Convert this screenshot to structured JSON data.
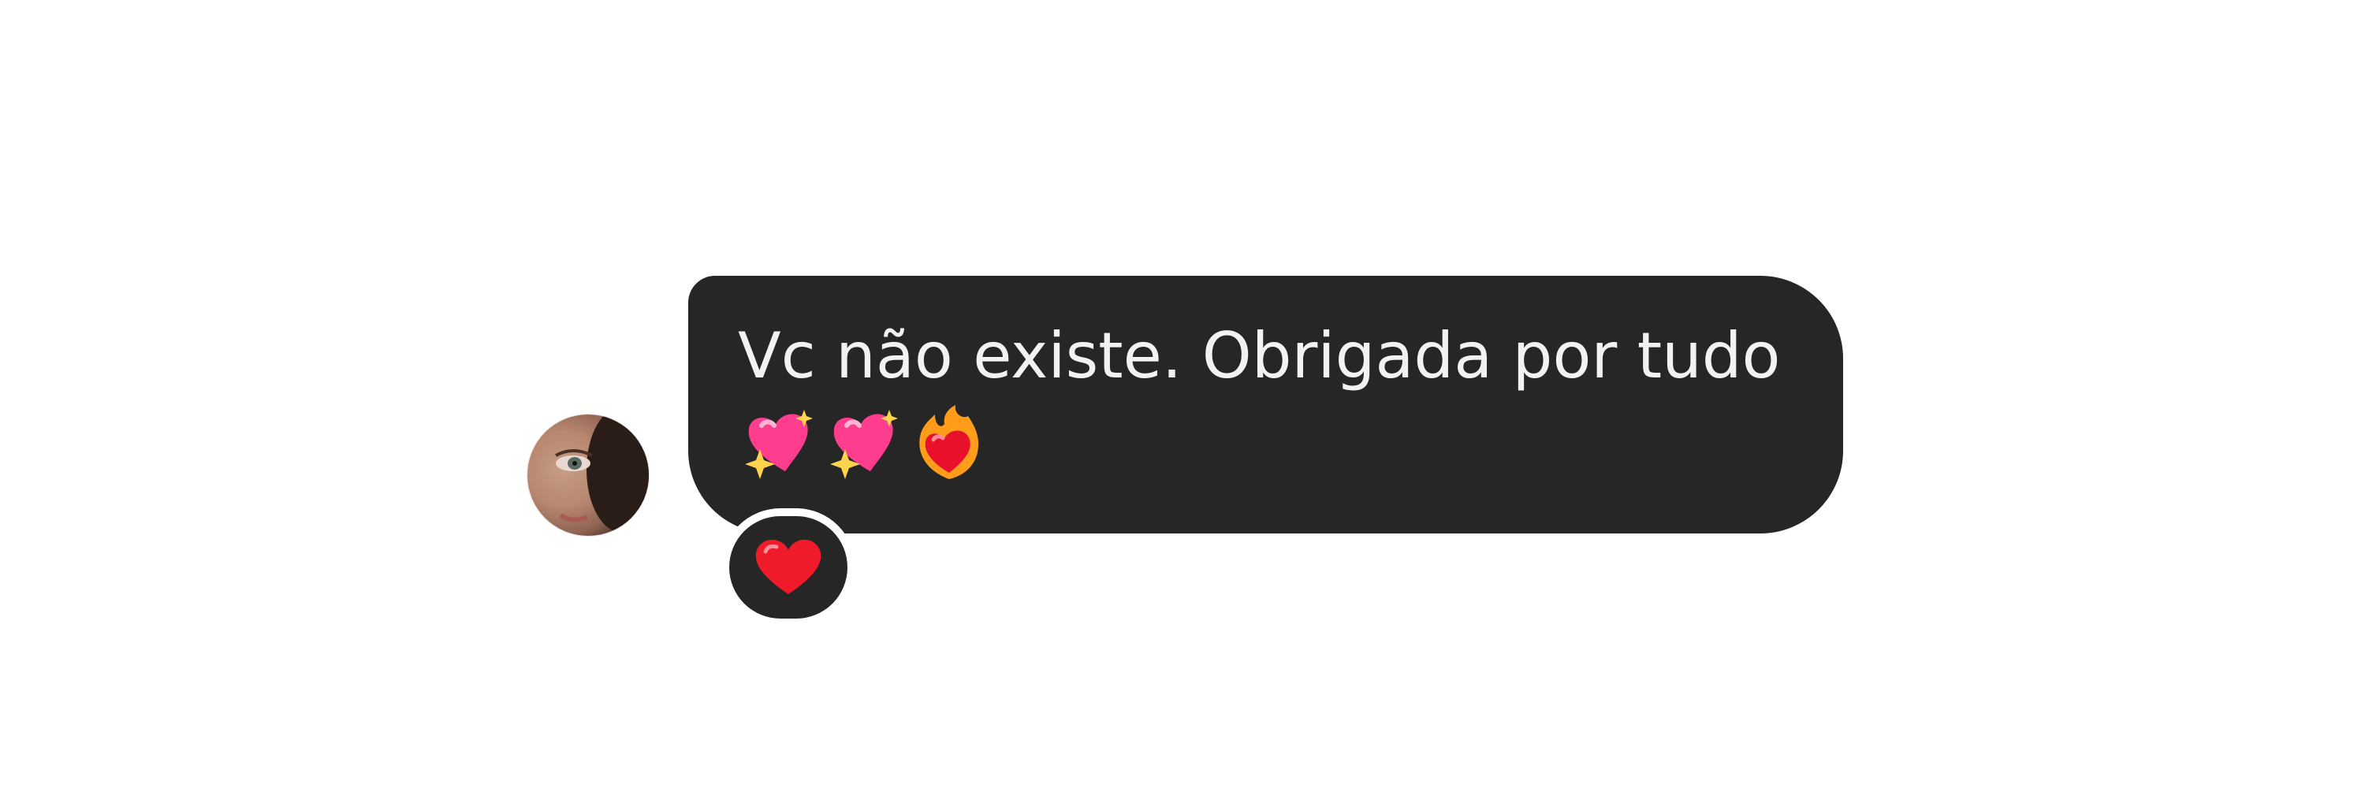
{
  "message": {
    "text": "Vc não existe. Obrigada por tudo",
    "emojis": [
      "sparkling-heart",
      "sparkling-heart",
      "heart-on-fire"
    ],
    "reaction": "red-heart"
  },
  "colors": {
    "bubble": "#262626",
    "text": "#f2f2f2",
    "background": "#ffffff"
  }
}
